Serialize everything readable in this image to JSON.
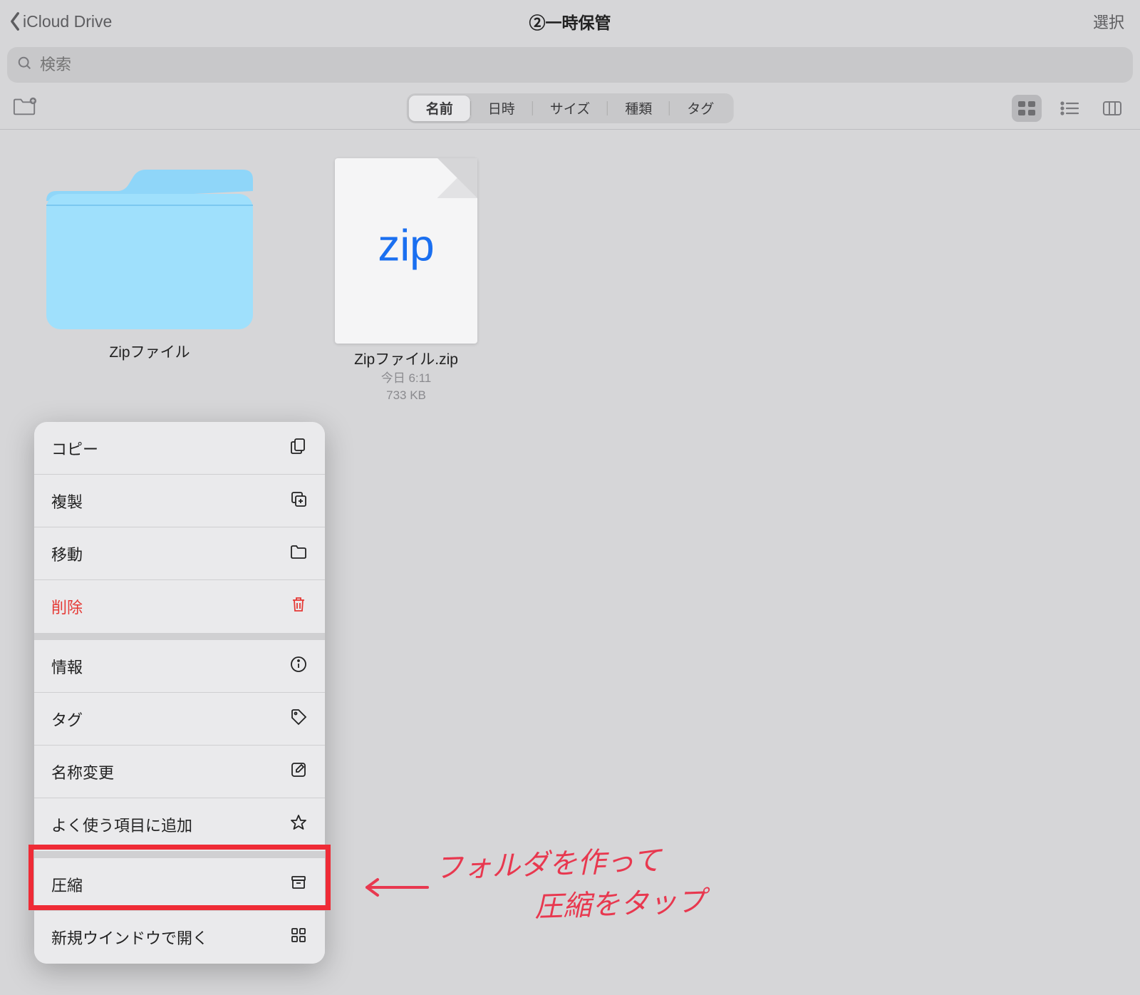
{
  "nav": {
    "back_label": "iCloud Drive",
    "title": "②一時保管",
    "select_label": "選択"
  },
  "search": {
    "placeholder": "検索"
  },
  "sort_tabs": [
    {
      "label": "名前",
      "active": true
    },
    {
      "label": "日時",
      "active": false
    },
    {
      "label": "サイズ",
      "active": false
    },
    {
      "label": "種類",
      "active": false
    },
    {
      "label": "タグ",
      "active": false
    }
  ],
  "items": {
    "folder": {
      "name": "Zipファイル"
    },
    "zip": {
      "name": "Zipファイル.zip",
      "date": "今日 6:11",
      "size": "733 KB",
      "glyph": "zip"
    }
  },
  "context_menu": {
    "group1": [
      {
        "label": "コピー",
        "icon": "copy"
      },
      {
        "label": "複製",
        "icon": "duplicate"
      },
      {
        "label": "移動",
        "icon": "folder"
      },
      {
        "label": "削除",
        "icon": "trash",
        "destructive": true
      }
    ],
    "group2": [
      {
        "label": "情報",
        "icon": "info"
      },
      {
        "label": "タグ",
        "icon": "tag"
      },
      {
        "label": "名称変更",
        "icon": "rename"
      },
      {
        "label": "よく使う項目に追加",
        "icon": "star"
      }
    ],
    "group3": [
      {
        "label": "圧縮",
        "icon": "archive"
      },
      {
        "label": "新規ウインドウで開く",
        "icon": "grid"
      }
    ]
  },
  "annotation": {
    "line1": "フォルダを作って",
    "line2": "圧縮をタップ"
  }
}
